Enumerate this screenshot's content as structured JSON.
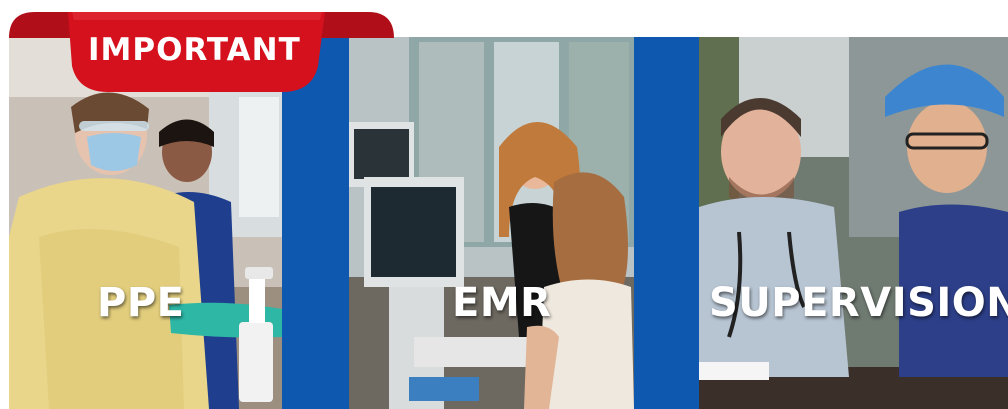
{
  "badge": {
    "text": "IMPORTANT"
  },
  "panels": [
    {
      "label": "PPE"
    },
    {
      "label": "EMR"
    },
    {
      "label": "SUPERVISION"
    }
  ],
  "colors": {
    "banner_red": "#d4111c",
    "divider_blue": "#0f58b0",
    "text_white": "#ffffff"
  }
}
